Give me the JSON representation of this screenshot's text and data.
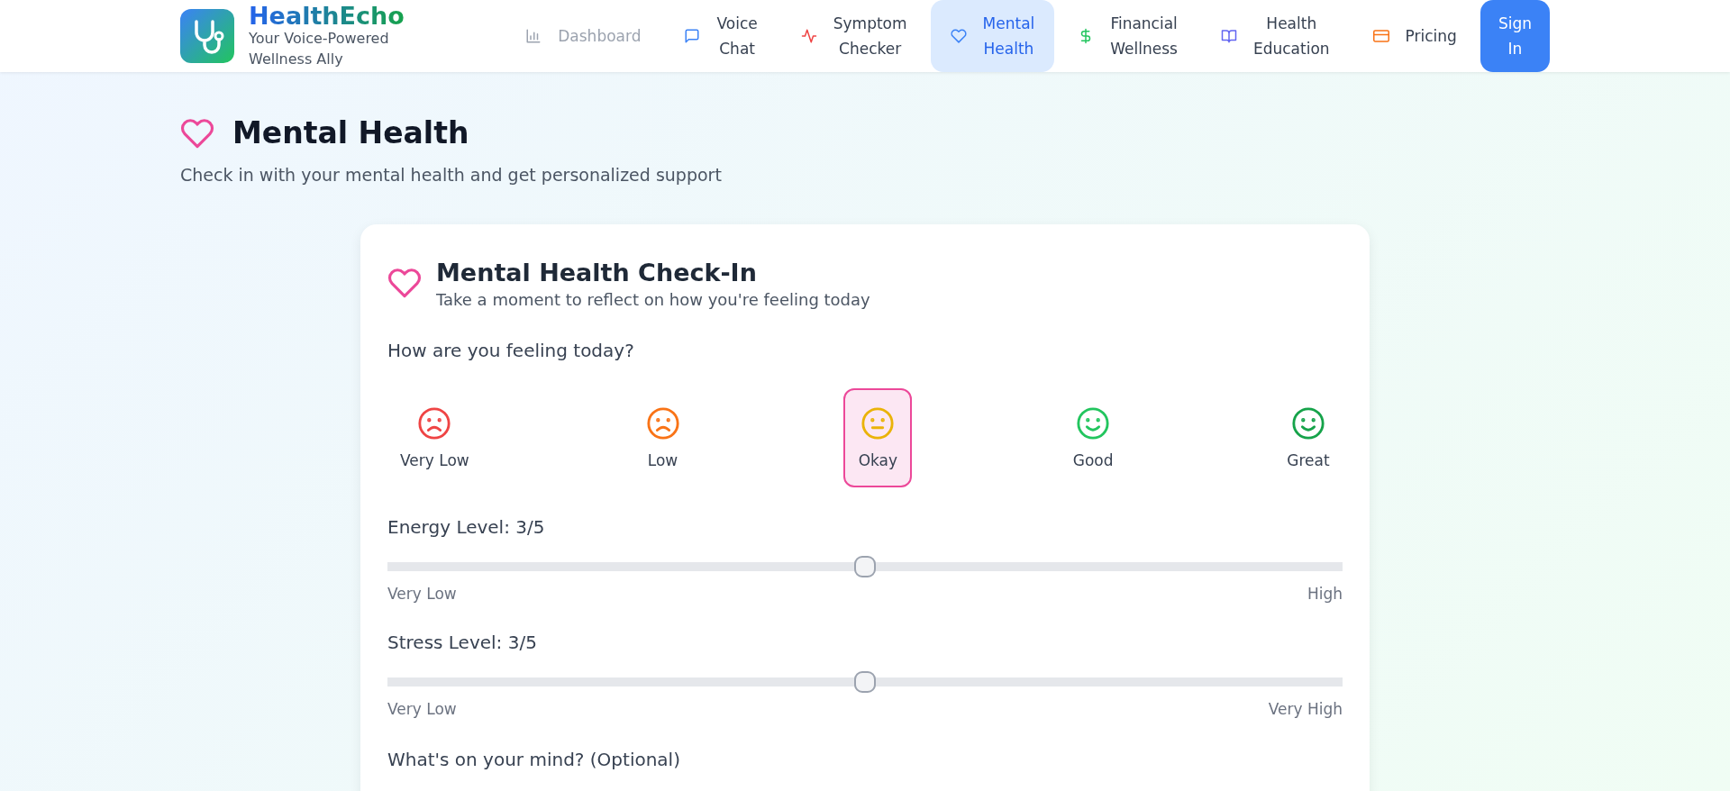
{
  "brand": {
    "name": "HealthEcho",
    "tagline": "Your Voice-Powered Wellness Ally"
  },
  "nav": [
    {
      "kind": "chart",
      "label": "Dashboard",
      "selected": false,
      "disabled": true
    },
    {
      "kind": "chat",
      "label": "Voice Chat",
      "selected": false,
      "disabled": false
    },
    {
      "kind": "pulse",
      "label": "Symptom Checker",
      "selected": false,
      "disabled": false
    },
    {
      "kind": "heart",
      "label": "Mental Health",
      "selected": true,
      "disabled": false
    },
    {
      "kind": "dollar",
      "label": "Financial Wellness",
      "selected": false,
      "disabled": false
    },
    {
      "kind": "book",
      "label": "Health Education",
      "selected": false,
      "disabled": false
    },
    {
      "kind": "card",
      "label": "Pricing",
      "selected": false,
      "disabled": false
    }
  ],
  "sign_in": "Sign In",
  "page": {
    "title": "Mental Health",
    "subtitle": "Check in with your mental health and get personalized support"
  },
  "checkin": {
    "title": "Mental Health Check-In",
    "subtitle": "Take a moment to reflect on how you're feeling today",
    "mood_question": "How are you feeling today?",
    "moods": [
      {
        "label": "Very Low",
        "kind": "sad",
        "color": "#ef4444",
        "selected": false
      },
      {
        "label": "Low",
        "kind": "sad",
        "color": "#f97316",
        "selected": false
      },
      {
        "label": "Okay",
        "kind": "neutral",
        "color": "#eab308",
        "selected": true
      },
      {
        "label": "Good",
        "kind": "happy",
        "color": "#22c55e",
        "selected": false
      },
      {
        "label": "Great",
        "kind": "happy",
        "color": "#16a34a",
        "selected": false
      }
    ],
    "sliders": [
      {
        "label": "Energy Level: 3/5",
        "level": 0.5,
        "min_label": "Very Low",
        "max_label": "High"
      },
      {
        "label": "Stress Level: 3/5",
        "level": 0.5,
        "min_label": "Very Low",
        "max_label": "Very High"
      }
    ],
    "notes_label": "What's on your mind? (Optional)"
  }
}
